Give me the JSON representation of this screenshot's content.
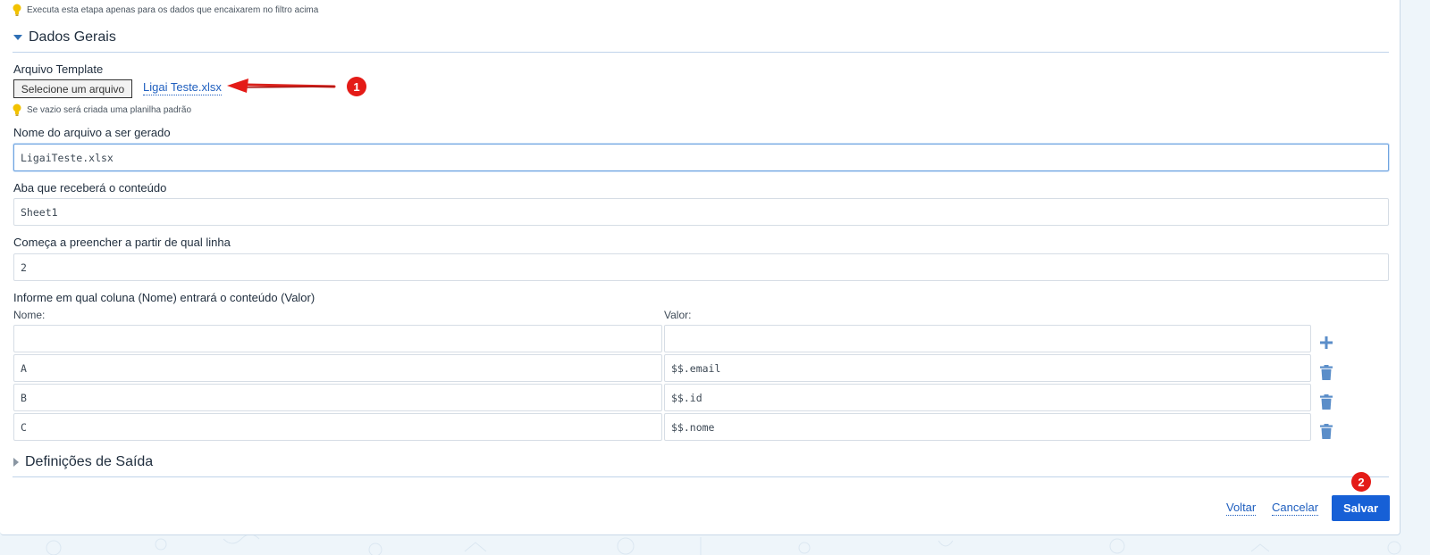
{
  "filter_hint": "Executa esta etapa apenas para os dados que encaixarem no filtro acima",
  "section_general": {
    "title": "Dados Gerais"
  },
  "template": {
    "label": "Arquivo Template",
    "select_button": "Selecione um arquivo",
    "file_name": "Ligai Teste.xlsx",
    "hint": "Se vazio será criada uma planilha padrão"
  },
  "output_file": {
    "label": "Nome do arquivo a ser gerado",
    "value": "LigaiTeste.xlsx"
  },
  "sheet": {
    "label": "Aba que receberá o conteúdo",
    "value": "Sheet1"
  },
  "start_row": {
    "label": "Começa a preencher a partir de qual linha",
    "value": "2"
  },
  "mapping": {
    "label": "Informe em qual coluna (Nome) entrará o conteúdo (Valor)",
    "name_header": "Nome:",
    "value_header": "Valor:",
    "new_row": {
      "name": "",
      "value": ""
    },
    "rows": [
      {
        "name": "A",
        "value": "$$.email"
      },
      {
        "name": "B",
        "value": "$$.id"
      },
      {
        "name": "C",
        "value": "$$.nome"
      }
    ]
  },
  "section_output": {
    "title": "Definições de Saída"
  },
  "footer": {
    "back": "Voltar",
    "cancel": "Cancelar",
    "save": "Salvar"
  },
  "annotations": {
    "badge1": "1",
    "badge2": "2"
  },
  "colors": {
    "accent": "#1760d6",
    "badge": "#e41b17",
    "icon": "#5b8ec9",
    "bulb": "#f2c200"
  }
}
